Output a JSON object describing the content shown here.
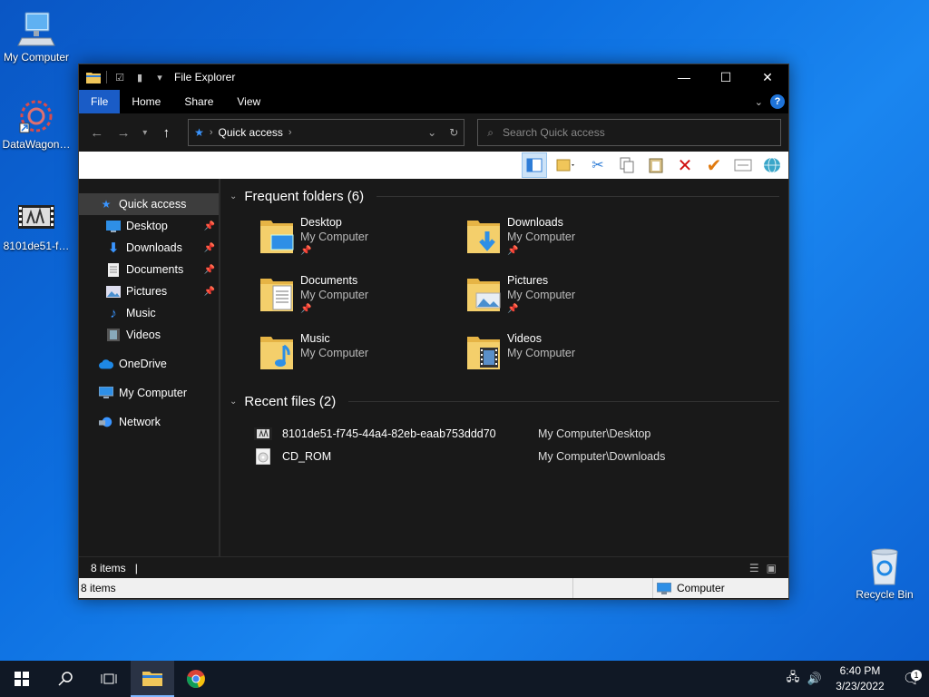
{
  "desktop": {
    "icons": [
      {
        "label": "My Computer",
        "icon": "computer-icon"
      },
      {
        "label": "DataWagon…",
        "icon": "datawagon-icon"
      },
      {
        "label": "8101de51-f…",
        "icon": "video-file-icon"
      },
      {
        "label": "Recycle Bin",
        "icon": "recycle-bin-icon"
      }
    ]
  },
  "window": {
    "title": "File Explorer",
    "ribbon_tabs": [
      "File",
      "Home",
      "Share",
      "View"
    ],
    "address": {
      "location": "Quick access"
    },
    "search": {
      "placeholder": "Search Quick access"
    },
    "nav": {
      "quick_access": "Quick access",
      "pinned": [
        "Desktop",
        "Downloads",
        "Documents",
        "Pictures"
      ],
      "unpinned": [
        "Music",
        "Videos"
      ],
      "onedrive": "OneDrive",
      "my_computer": "My Computer",
      "network": "Network"
    },
    "frequent": {
      "heading": "Frequent folders (6)",
      "items": [
        {
          "name": "Desktop",
          "location": "My Computer",
          "pinned": true
        },
        {
          "name": "Downloads",
          "location": "My Computer",
          "pinned": true
        },
        {
          "name": "Documents",
          "location": "My Computer",
          "pinned": true
        },
        {
          "name": "Pictures",
          "location": "My Computer",
          "pinned": true
        },
        {
          "name": "Music",
          "location": "My Computer",
          "pinned": false
        },
        {
          "name": "Videos",
          "location": "My Computer",
          "pinned": false
        }
      ]
    },
    "recent": {
      "heading": "Recent files (2)",
      "items": [
        {
          "name": "8101de51-f745-44a4-82eb-eaab753ddd70",
          "path": "My Computer\\Desktop"
        },
        {
          "name": "CD_ROM",
          "path": "My Computer\\Downloads"
        }
      ]
    },
    "status": {
      "items": "8 items"
    },
    "bottom": {
      "items": "8 items",
      "zone": "Computer"
    }
  },
  "taskbar": {
    "time": "6:40 PM",
    "date": "3/23/2022",
    "notifications": "1"
  },
  "colors": {
    "accent": "#1a5cc6",
    "folder": "#f0c65a"
  }
}
